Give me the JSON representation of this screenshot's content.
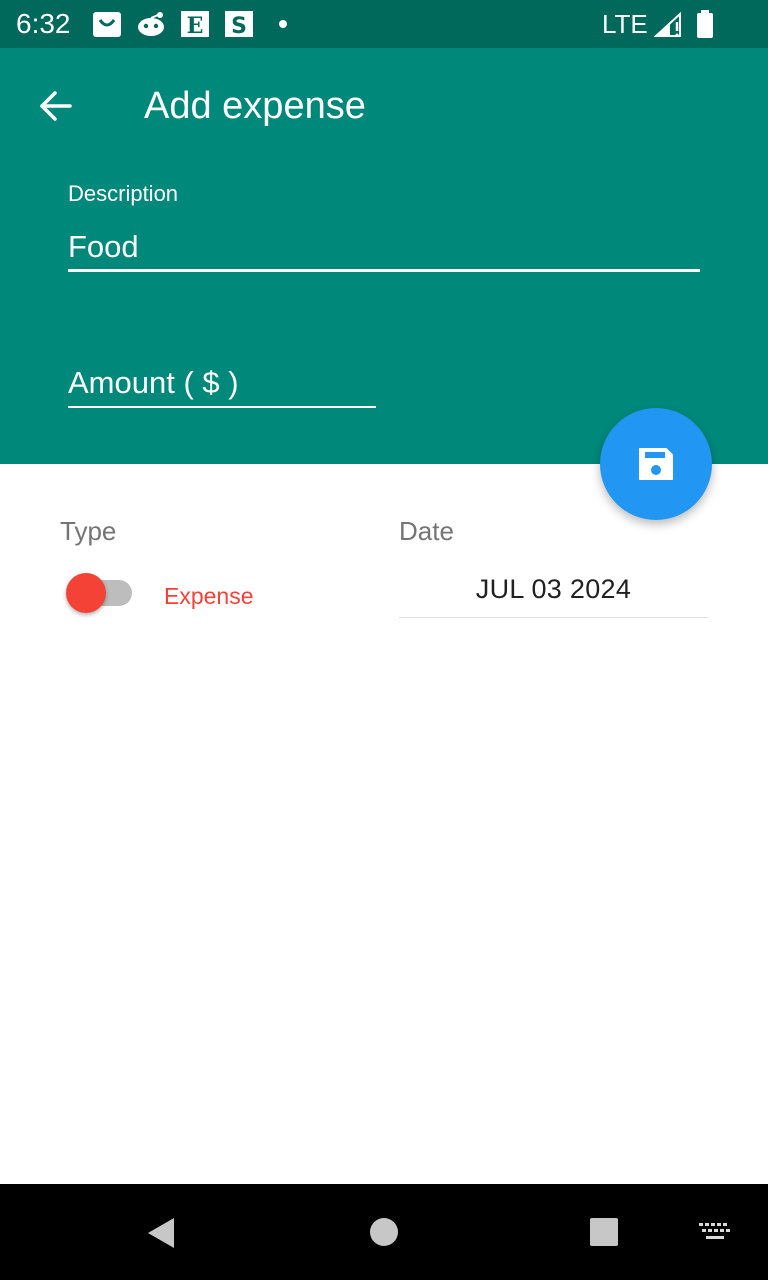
{
  "status_bar": {
    "time": "6:32",
    "network": "LTE",
    "notification_icons": [
      "shopping-bag-icon",
      "reddit-icon",
      "etsy-icon",
      "s-app-icon",
      "more-dot-icon"
    ],
    "etsy_letter": "E",
    "s_letter": "S"
  },
  "header": {
    "back_icon": "arrow-back-icon",
    "title": "Add expense"
  },
  "form": {
    "description_label": "Description",
    "description_value": "Food",
    "amount_placeholder": "Amount ( $ )"
  },
  "fab": {
    "icon": "save-icon"
  },
  "type_section": {
    "label": "Type",
    "toggle_on": false,
    "value": "Expense",
    "value_color": "#f44336"
  },
  "date_section": {
    "label": "Date",
    "value": "JUL 03 2024"
  },
  "colors": {
    "status_bar": "#00695c",
    "primary": "#00897b",
    "fab": "#2196f3",
    "expense_red": "#f44336"
  },
  "nav_bar": {
    "buttons": [
      "back-triangle-icon",
      "home-circle-icon",
      "recents-square-icon",
      "keyboard-icon"
    ]
  }
}
